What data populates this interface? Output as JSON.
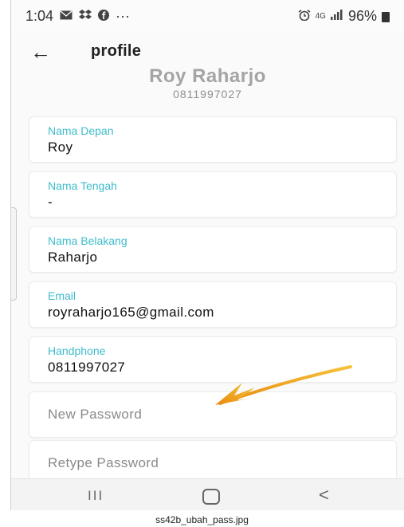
{
  "statusbar": {
    "time": "1:04",
    "left_icons": [
      "mail-icon",
      "dropbox-icon",
      "facebook-icon"
    ],
    "dots": "···",
    "network": "4G",
    "battery": "96%"
  },
  "appbar": {
    "back_icon": "←",
    "title": "profile"
  },
  "profile": {
    "name": "Roy Raharjo",
    "phone": "0811997027"
  },
  "fields": {
    "nama_depan": {
      "label": "Nama Depan",
      "value": "Roy"
    },
    "nama_tengah": {
      "label": "Nama Tengah",
      "value": "-"
    },
    "nama_belakang": {
      "label": "Nama Belakang",
      "value": "Raharjo"
    },
    "email": {
      "label": "Email",
      "value": "royraharjo165@gmail.com"
    },
    "handphone": {
      "label": "Handphone",
      "value": "0811997027"
    },
    "new_password": {
      "placeholder": "New Password"
    },
    "retype_password": {
      "placeholder": "Retype Password"
    }
  },
  "navbar": {
    "recent": "III",
    "back": "<"
  },
  "caption": "ss42b_ubah_pass.jpg",
  "colors": {
    "label_accent": "#3fbccb",
    "annotation_arrow": "#f0a818"
  }
}
